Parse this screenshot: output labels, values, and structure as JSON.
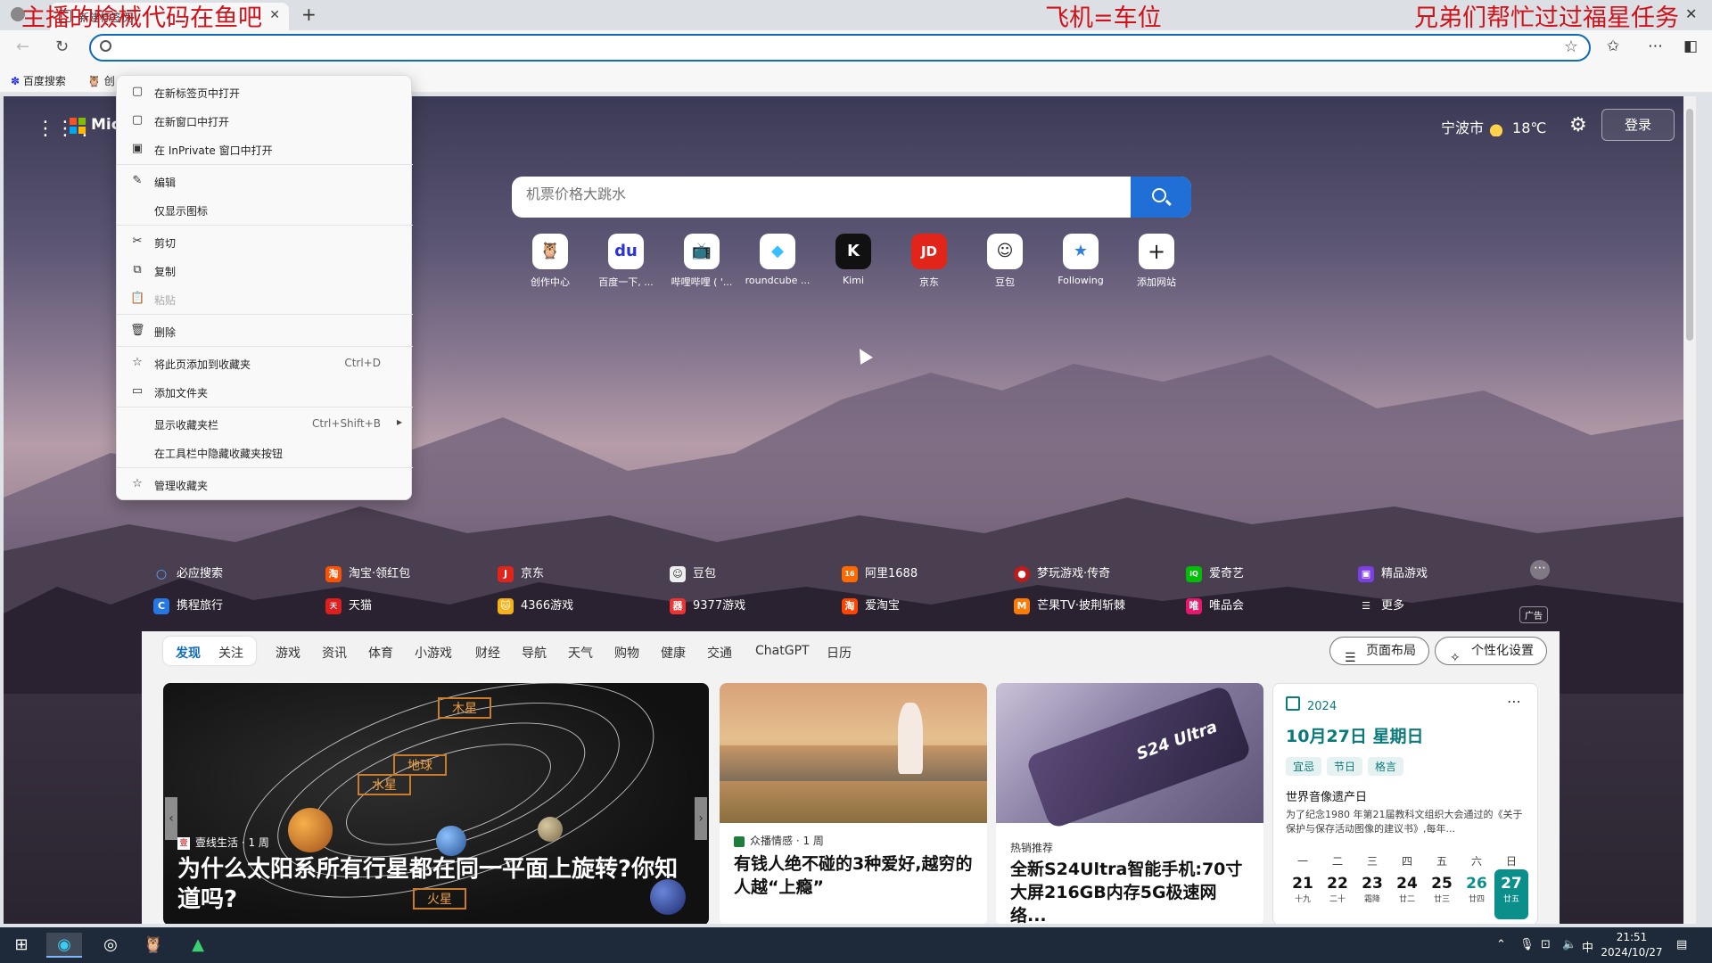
{
  "browser": {
    "tab_title": "新建标签页",
    "overlay_texts": [
      "主播的檢械代码在鱼吧",
      "飞机=车位",
      "兄弟们帮忙过过福星任务"
    ],
    "address_value": "",
    "bookmarks": [
      "百度搜索",
      "创"
    ]
  },
  "page": {
    "brand": "Mic",
    "weather_city": "宁波市",
    "weather_temp": "18℃",
    "login_label": "登录",
    "search_placeholder": "机票价格大跳水",
    "tiles": [
      {
        "label": "创作中心",
        "icon": "🦉"
      },
      {
        "label": "百度一下, ...",
        "icon": "du"
      },
      {
        "label": "哔哩哔哩 ( '...",
        "icon": "📺"
      },
      {
        "label": "roundcube ...",
        "icon": "◆"
      },
      {
        "label": "Kimi",
        "icon": "K"
      },
      {
        "label": "京东",
        "icon": "JD"
      },
      {
        "label": "豆包",
        "icon": "☺"
      },
      {
        "label": "Following",
        "icon": "★"
      },
      {
        "label": "添加网站",
        "icon": "+"
      }
    ],
    "quick_links_row1": [
      "必应搜索",
      "淘宝·领红包",
      "京东",
      "豆包",
      "阿里1688",
      "梦玩游戏·传奇",
      "爱奇艺",
      "精品游戏"
    ],
    "quick_links_row2": [
      "携程旅行",
      "天猫",
      "4366游戏",
      "9377游戏",
      "爱淘宝",
      "芒果TV·披荆斩棘",
      "唯品会",
      "更多"
    ],
    "ad_label": "广告"
  },
  "feed": {
    "tabs": [
      "发现",
      "关注",
      "游戏",
      "资讯",
      "体育",
      "小游戏",
      "财经",
      "导航",
      "天气",
      "购物",
      "健康",
      "交通",
      "ChatGPT",
      "日历"
    ],
    "layout_button": "页面布局",
    "personalize_button": "个性化设置",
    "card1": {
      "source": "壹线生活 · 1 周",
      "headline": "为什么太阳系所有行星都在同一平面上旋转?你知道吗?",
      "labels": [
        "木星",
        "地球",
        "水星",
        "火星"
      ]
    },
    "card2": {
      "source": "众播情感 · 1 周",
      "headline": "有钱人绝不碰的3种爱好,越穷的人越“上瘾”"
    },
    "card3": {
      "tag": "热销推荐",
      "phone_text": "S24 Ultra",
      "headline": "全新S24Ultra智能手机:70寸大屏216GB内存5G极速网络..."
    },
    "calendar": {
      "year": "2024",
      "date": "10月27日 星期日",
      "chips": [
        "宜忌",
        "节日",
        "格言"
      ],
      "event_title": "世界音像遗产日",
      "event_desc": "为了纪念1980 年第21届教科文组织大会通过的《关于保护与保存活动图像的建议书》,每年...",
      "weekdays": [
        "一",
        "二",
        "三",
        "四",
        "五",
        "六",
        "日"
      ],
      "days": [
        {
          "n": "21",
          "l": "十九"
        },
        {
          "n": "22",
          "l": "二十"
        },
        {
          "n": "23",
          "l": "霜降"
        },
        {
          "n": "24",
          "l": "廿二"
        },
        {
          "n": "25",
          "l": "廿三"
        },
        {
          "n": "26",
          "l": "廿四"
        },
        {
          "n": "27",
          "l": "廿五"
        }
      ]
    }
  },
  "context_menu": {
    "items": [
      {
        "label": "在新标签页中打开",
        "icon": "▢"
      },
      {
        "label": "在新窗口中打开",
        "icon": "▢"
      },
      {
        "label": "在 InPrivate 窗口中打开",
        "icon": "▣"
      },
      {
        "label": "编辑",
        "icon": "✎"
      },
      {
        "label": "仅显示图标",
        "icon": ""
      },
      {
        "label": "剪切",
        "icon": "✂"
      },
      {
        "label": "复制",
        "icon": "⧉"
      },
      {
        "label": "粘贴",
        "icon": "📋"
      },
      {
        "label": "删除",
        "icon": "🗑"
      },
      {
        "label": "将此页添加到收藏夹",
        "icon": "☆",
        "shortcut": "Ctrl+D"
      },
      {
        "label": "添加文件夹",
        "icon": "▭"
      },
      {
        "label": "显示收藏夹栏",
        "icon": "",
        "shortcut": "Ctrl+Shift+B"
      },
      {
        "label": "在工具栏中隐藏收藏夹按钮",
        "icon": ""
      },
      {
        "label": "管理收藏夹",
        "icon": "☆"
      }
    ]
  },
  "taskbar": {
    "time": "21:51",
    "date": "2024/10/27",
    "ime": "中"
  }
}
